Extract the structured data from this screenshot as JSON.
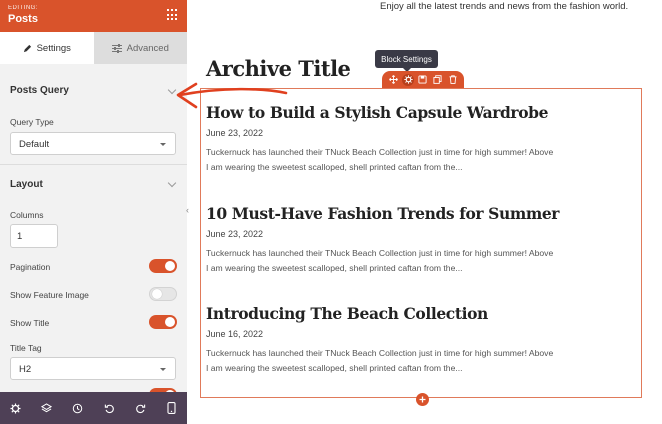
{
  "panel": {
    "editing_label": "EDITING:",
    "title": "Posts",
    "tabs": [
      {
        "label": "Settings",
        "icon": "pencil-icon"
      },
      {
        "label": "Advanced",
        "icon": "sliders-icon"
      }
    ],
    "sections": {
      "posts_query": {
        "title": "Posts Query",
        "query_type_label": "Query Type",
        "query_type_value": "Default"
      },
      "layout": {
        "title": "Layout",
        "columns_label": "Columns",
        "columns_value": "1",
        "pagination_label": "Pagination",
        "pagination_on": true,
        "feature_image_label": "Show Feature Image",
        "feature_image_on": false,
        "show_title_label": "Show Title",
        "show_title_on": true,
        "title_tag_label": "Title Tag",
        "title_tag_value": "H2"
      }
    },
    "footer_icons": [
      "gear-icon",
      "layers-icon",
      "history-icon",
      "undo-icon",
      "redo-icon",
      "mobile-icon"
    ]
  },
  "preview": {
    "tagline": "Enjoy all the latest trends and news from the fashion world.",
    "archive_title": "Archive Title",
    "tooltip": "Block Settings",
    "posts": [
      {
        "title": "How to Build a Stylish Capsule Wardrobe",
        "date": "June 23, 2022",
        "excerpt_1": "Tuckernuck has launched their TNuck Beach Collection just in time for high summer! Above",
        "excerpt_2": "I am wearing the sweetest scalloped, shell printed caftan from the..."
      },
      {
        "title": "10 Must-Have Fashion Trends for Summer",
        "date": "June 23, 2022",
        "excerpt_1": "Tuckernuck has launched their TNuck Beach Collection just in time for high summer! Above",
        "excerpt_2": "I am wearing the sweetest scalloped, shell printed caftan from the..."
      },
      {
        "title": "Introducing The Beach Collection",
        "date": "June 16, 2022",
        "excerpt_1": "Tuckernuck has launched their TNuck Beach Collection just in time for high summer! Above",
        "excerpt_2": "I am wearing the sweetest scalloped, shell printed caftan from the..."
      }
    ]
  },
  "colors": {
    "accent": "#d9532b",
    "footer": "#4e4056",
    "tooltip": "#3a3a46"
  }
}
